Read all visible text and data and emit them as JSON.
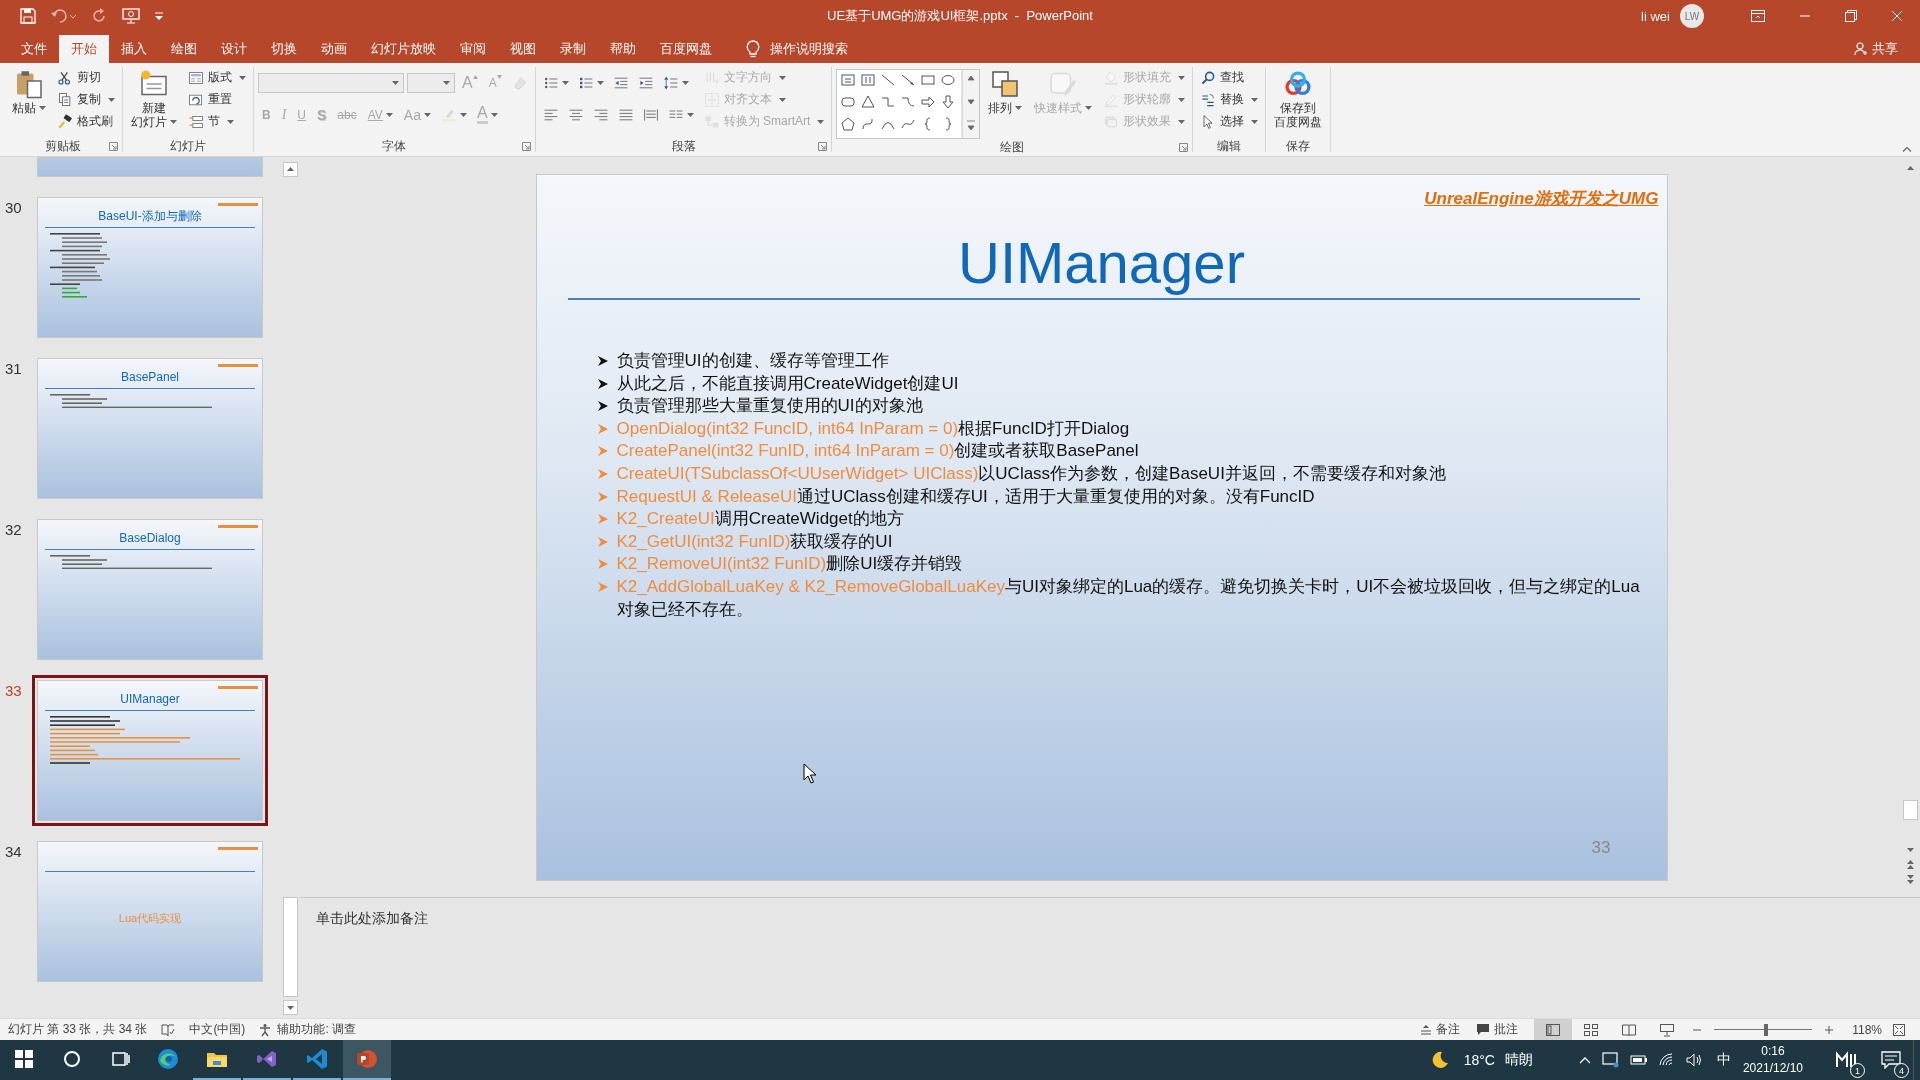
{
  "window": {
    "title": "UE基于UMG的游戏UI框架.pptx  -  PowerPoint",
    "user": "li wei",
    "initials": "LW",
    "share": "共享"
  },
  "tabs": [
    {
      "label": "文件",
      "selected": false
    },
    {
      "label": "开始",
      "selected": true
    },
    {
      "label": "插入",
      "selected": false
    },
    {
      "label": "绘图",
      "selected": false
    },
    {
      "label": "设计",
      "selected": false
    },
    {
      "label": "切换",
      "selected": false
    },
    {
      "label": "动画",
      "selected": false
    },
    {
      "label": "幻灯片放映",
      "selected": false
    },
    {
      "label": "审阅",
      "selected": false
    },
    {
      "label": "视图",
      "selected": false
    },
    {
      "label": "录制",
      "selected": false
    },
    {
      "label": "帮助",
      "selected": false
    },
    {
      "label": "百度网盘",
      "selected": false
    }
  ],
  "tell_me": "操作说明搜索",
  "ribbon": [
    {
      "label": "剪贴板",
      "launcher": true,
      "columns": [
        [
          {
            "kind": "large",
            "lines": [
              "粘贴"
            ],
            "dropdown": true,
            "disabled": false
          }
        ],
        [
          {
            "kind": "small",
            "label": "剪切",
            "dropdown": false,
            "disabled": false
          },
          {
            "kind": "small",
            "label": "复制",
            "dropdown": true,
            "disabled": false
          },
          {
            "kind": "small",
            "label": "格式刷",
            "dropdown": false,
            "disabled": false
          }
        ]
      ]
    },
    {
      "label": "幻灯片",
      "launcher": false,
      "columns": [
        [
          {
            "kind": "large",
            "lines": [
              "新建",
              "幻灯片"
            ],
            "dropdown": true,
            "disabled": false
          }
        ],
        [
          {
            "kind": "small",
            "label": "版式",
            "dropdown": true,
            "disabled": false
          },
          {
            "kind": "small",
            "label": "重置",
            "dropdown": false,
            "disabled": false
          },
          {
            "kind": "small",
            "label": "节",
            "dropdown": true,
            "disabled": false
          }
        ]
      ]
    },
    {
      "label": "字体",
      "launcher": true,
      "columns": [
        [
          {
            "kind": "row",
            "items": [
              {
                "kind": "font-field",
                "disabled": true
              },
              {
                "kind": "size-field",
                "disabled": true
              },
              {
                "kind": "grow",
                "text": "A",
                "dropdown": false,
                "disabled": true
              },
              {
                "kind": "shrink",
                "text": "A",
                "dropdown": false,
                "disabled": true
              },
              {
                "kind": "icon",
                "dropdown": false,
                "disabled": true
              }
            ]
          },
          {
            "kind": "row",
            "items": [
              {
                "kind": "bold",
                "text": "B",
                "dropdown": false,
                "disabled": true
              },
              {
                "kind": "italic",
                "text": "I",
                "dropdown": false,
                "disabled": true
              },
              {
                "kind": "underline",
                "text": "U",
                "dropdown": false,
                "disabled": true
              },
              {
                "kind": "shadow",
                "text": "S",
                "dropdown": false,
                "disabled": true
              },
              {
                "kind": "strike",
                "text": "abc",
                "dropdown": false,
                "disabled": true
              },
              {
                "kind": "spacing",
                "text": "AV",
                "dropdown": true,
                "disabled": true
              },
              {
                "kind": "case",
                "text": "Aa",
                "dropdown": true,
                "disabled": true
              },
              {
                "kind": "icon",
                "dropdown": true,
                "disabled": true
              },
              {
                "kind": "color",
                "text": "A",
                "dropdown": true,
                "disabled": true
              }
            ]
          }
        ]
      ]
    },
    {
      "label": "段落",
      "launcher": true,
      "columns": [
        [
          {
            "kind": "row",
            "items": [
              {
                "kind": "icon",
                "dropdown": true,
                "disabled": false
              },
              {
                "kind": "icon",
                "dropdown": true,
                "disabled": false
              },
              {
                "kind": "icon",
                "dropdown": false,
                "disabled": false
              },
              {
                "kind": "icon",
                "dropdown": false,
                "disabled": false
              },
              {
                "kind": "icon",
                "dropdown": true,
                "disabled": false
              }
            ]
          },
          {
            "kind": "row",
            "items": [
              {
                "kind": "icon",
                "dropdown": false,
                "disabled": false
              },
              {
                "kind": "icon",
                "dropdown": false,
                "disabled": false
              },
              {
                "kind": "icon",
                "dropdown": false,
                "disabled": false
              },
              {
                "kind": "icon",
                "dropdown": false,
                "disabled": false
              },
              {
                "kind": "icon",
                "dropdown": false,
                "disabled": false
              },
              {
                "kind": "icon",
                "dropdown": true,
                "disabled": false
              }
            ]
          }
        ],
        [
          {
            "kind": "small",
            "label": "文字方向",
            "dropdown": true,
            "disabled": true
          },
          {
            "kind": "small",
            "label": "对齐文本",
            "dropdown": true,
            "disabled": true
          },
          {
            "kind": "small",
            "label": "转换为 SmartArt",
            "dropdown": true,
            "disabled": true
          }
        ]
      ]
    },
    {
      "label": "绘图",
      "launcher": true,
      "columns": [
        [
          {
            "kind": "gallery"
          }
        ],
        [
          {
            "kind": "large",
            "lines": [
              "排列"
            ],
            "dropdown": true,
            "disabled": false
          }
        ],
        [
          {
            "kind": "large",
            "lines": [
              "快速样式"
            ],
            "dropdown": true,
            "disabled": true
          }
        ],
        [
          {
            "kind": "small",
            "label": "形状填充",
            "dropdown": true,
            "disabled": true
          },
          {
            "kind": "small",
            "label": "形状轮廓",
            "dropdown": true,
            "disabled": true
          },
          {
            "kind": "small",
            "label": "形状效果",
            "dropdown": true,
            "disabled": true
          }
        ]
      ]
    },
    {
      "label": "编辑",
      "launcher": false,
      "columns": [
        [
          {
            "kind": "small",
            "label": "查找",
            "dropdown": false,
            "disabled": false
          },
          {
            "kind": "small",
            "label": "替换",
            "dropdown": true,
            "disabled": false
          },
          {
            "kind": "small",
            "label": "选择",
            "dropdown": true,
            "disabled": false
          }
        ]
      ]
    },
    {
      "label": "保存",
      "launcher": false,
      "columns": [
        [
          {
            "kind": "large",
            "lines": [
              "保存到",
              "百度网盘"
            ],
            "dropdown": false,
            "disabled": false
          }
        ]
      ]
    }
  ],
  "thumbnails": [
    {
      "kind": "cut",
      "selected": false
    },
    {
      "number": "30",
      "title": "BaseUI-添加与删除",
      "kind": "outline",
      "selected": false
    },
    {
      "number": "31",
      "title": "BasePanel",
      "kind": "bullets",
      "selected": false
    },
    {
      "number": "32",
      "title": "BaseDialog",
      "kind": "bullets",
      "selected": false
    },
    {
      "number": "33",
      "title": "UIManager",
      "kind": "mixed",
      "selected": true
    },
    {
      "number": "34",
      "body": "Lua代码实现",
      "kind": "section",
      "selected": false
    }
  ],
  "slide": {
    "header": "UnrealEngine游戏开发之UMG",
    "title": "UIManager",
    "page": "33",
    "bullets": [
      {
        "kind": "plain",
        "text": "负责管理UI的创建、缓存等管理工作"
      },
      {
        "kind": "plain",
        "text": "从此之后，不能直接调用CreateWidget创建UI"
      },
      {
        "kind": "plain",
        "text": "负责管理那些大量重复使用的UI的对象池"
      },
      {
        "kind": "api",
        "code": "OpenDialog(int32 FuncID, int64 InParam = 0)",
        "text": "根据FuncID打开Dialog"
      },
      {
        "kind": "api",
        "code": "CreatePanel(int32 FunID, int64 InParam = 0)",
        "text": "创建或者获取BasePanel"
      },
      {
        "kind": "api",
        "code": "CreateUI(TSubclassOf<UUserWidget> UIClass)",
        "text": "以UClass作为参数，创建BaseUI并返回，不需要缓存和对象池"
      },
      {
        "kind": "api",
        "code": "RequestUI & ReleaseUI",
        "text": "通过UClass创建和缓存UI，适用于大量重复使用的对象。没有FuncID"
      },
      {
        "kind": "api",
        "code": "K2_CreateUI",
        "text": "调用CreateWidget的地方"
      },
      {
        "kind": "api",
        "code": "K2_GetUI(int32 FunID)",
        "text": "获取缓存的UI"
      },
      {
        "kind": "api",
        "code": "K2_RemoveUI(int32 FunID)",
        "text": "删除UI缓存并销毁"
      },
      {
        "kind": "api",
        "code": "K2_AddGlobalLuaKey & K2_RemoveGlobalLuaKey",
        "text": "与UI对象绑定的Lua的缓存。避免切换关卡时，UI不会被垃圾回收，但与之绑定的Lua对象已经不存在。"
      }
    ]
  },
  "notes": {
    "placeholder": "单击此处添加备注"
  },
  "status": {
    "slide_info": "幻灯片 第 33 张，共 34 张",
    "language": "中文(中国)",
    "accessibility": "辅助功能: 调查",
    "notes": "备注",
    "comments": "批注",
    "views": [
      {
        "selected": true
      },
      {
        "selected": false
      },
      {
        "selected": false
      },
      {
        "selected": false
      }
    ],
    "zoom": {
      "level": 0.53,
      "reading": "118%"
    }
  },
  "taskbar": {
    "apps": [
      {
        "running": false,
        "selected": false
      },
      {
        "running": false,
        "selected": false
      },
      {
        "running": false,
        "selected": false
      },
      {
        "running": false,
        "selected": false
      },
      {
        "running": true,
        "selected": false
      },
      {
        "running": true,
        "selected": false
      },
      {
        "running": true,
        "selected": false
      },
      {
        "running": true,
        "selected": true
      }
    ],
    "temperature": "18°C",
    "weather": "晴朗",
    "ime": "中",
    "time": "0:16",
    "date": "2021/12/10",
    "app_badge": "1",
    "notification_badge": "4"
  }
}
